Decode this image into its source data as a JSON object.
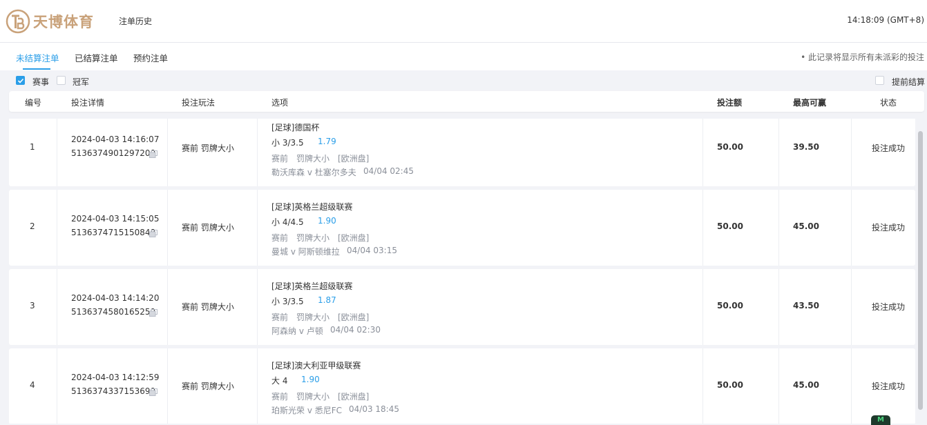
{
  "header": {
    "logo_text": "天博体育",
    "page_title": "注单历史",
    "clock": "14:18:09 (GMT+8)"
  },
  "tabs": [
    {
      "label": "未结算注单",
      "active": true
    },
    {
      "label": "已结算注单",
      "active": false
    },
    {
      "label": "预约注单",
      "active": false
    }
  ],
  "notice": "• 此记录将显示所有未派彩的投注",
  "filters": {
    "event": {
      "label": "赛事",
      "checked": true
    },
    "champion": {
      "label": "冠军",
      "checked": false
    },
    "cashout": {
      "label": "提前结算",
      "checked": false
    }
  },
  "table": {
    "columns": {
      "no": "编号",
      "detail": "投注详情",
      "play": "投注玩法",
      "selection": "选项",
      "stake": "投注额",
      "max_win": "最高可赢",
      "status": "状态"
    },
    "rows": [
      {
        "no": "1",
        "datetime": "2024-04-03 14:16:07",
        "bet_id": "5136374901297200",
        "play": "赛前 罚牌大小",
        "league": "[足球]德国杯",
        "pick": "小 3/3.5",
        "odds": "1.79",
        "meta": "赛前　罚牌大小　[欧洲盘]",
        "match": "勒沃库森 v 杜塞尔多夫",
        "kickoff": "04/04 02:45",
        "stake": "50.00",
        "max_win": "39.50",
        "status": "投注成功"
      },
      {
        "no": "2",
        "datetime": "2024-04-03 14:15:05",
        "bet_id": "5136374715150848",
        "play": "赛前 罚牌大小",
        "league": "[足球]英格兰超级联赛",
        "pick": "小 4/4.5",
        "odds": "1.90",
        "meta": "赛前　罚牌大小　[欧洲盘]",
        "match": "曼城 v 阿斯顿维拉",
        "kickoff": "04/04 03:15",
        "stake": "50.00",
        "max_win": "45.00",
        "status": "投注成功"
      },
      {
        "no": "3",
        "datetime": "2024-04-03 14:14:20",
        "bet_id": "5136374580165259",
        "play": "赛前 罚牌大小",
        "league": "[足球]英格兰超级联赛",
        "pick": "小 3/3.5",
        "odds": "1.87",
        "meta": "赛前　罚牌大小　[欧洲盘]",
        "match": "阿森纳 v 卢顿",
        "kickoff": "04/04 02:30",
        "stake": "50.00",
        "max_win": "43.50",
        "status": "投注成功"
      },
      {
        "no": "4",
        "datetime": "2024-04-03 14:12:59",
        "bet_id": "5136374337153699",
        "play": "赛前 罚牌大小",
        "league": "[足球]澳大利亚甲级联赛",
        "pick": "大 4",
        "odds": "1.90",
        "meta": "赛前　罚牌大小　[欧洲盘]",
        "match": "珀斯光荣 v 悉尼FC",
        "kickoff": "04/03 18:45",
        "stake": "50.00",
        "max_win": "45.00",
        "status": "投注成功"
      }
    ]
  },
  "badge_text": "M",
  "colors": {
    "accent": "#2a9ee8",
    "brand_gold": "#c9a27a",
    "background": "#f2f3f7"
  }
}
